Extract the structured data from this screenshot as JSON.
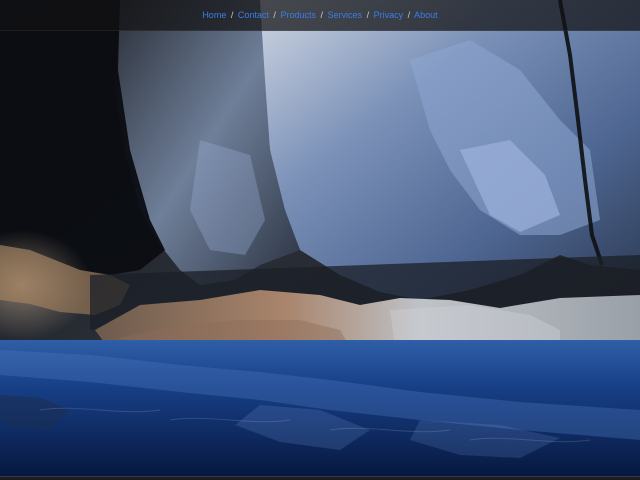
{
  "nav": {
    "links": [
      {
        "label": "Home"
      },
      {
        "label": "Contact"
      },
      {
        "label": "Products"
      },
      {
        "label": "Services"
      },
      {
        "label": "Privacy"
      },
      {
        "label": "About"
      }
    ],
    "separator": "/"
  },
  "hero": {
    "subject": "ice-cave-photo",
    "colors": {
      "shadow": "#0b0d12",
      "rock_blue": "#6f86ad",
      "rock_light": "#c7ced8",
      "rock_warm": "#a8836c",
      "water_deep": "#0b2a66",
      "water_light": "#3f6db7"
    }
  },
  "colors": {
    "link": "#3d7ee6",
    "topbar": "#121214"
  }
}
